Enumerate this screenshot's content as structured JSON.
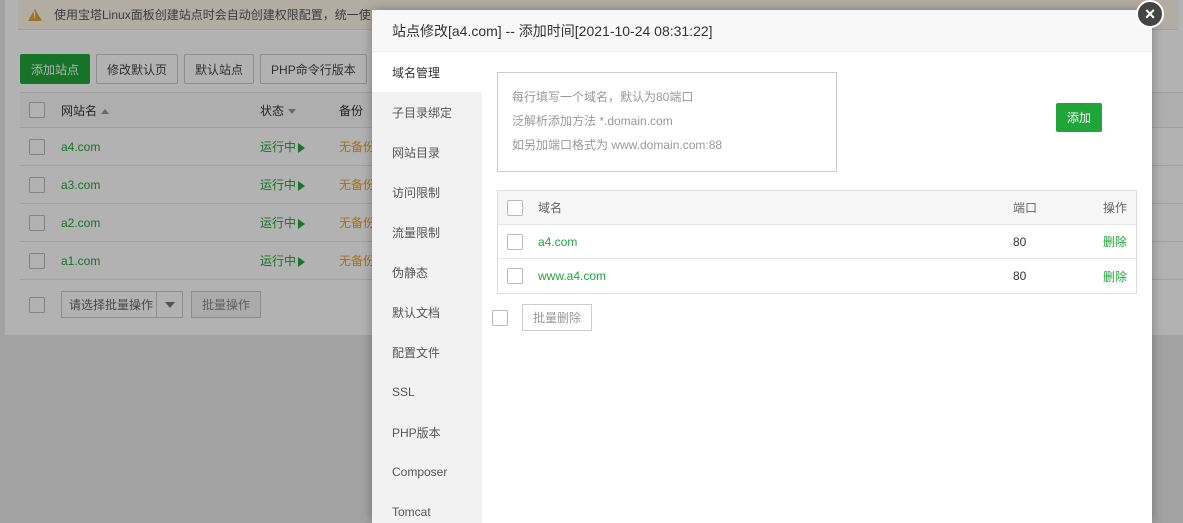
{
  "notice": {
    "text": "使用宝塔Linux面板创建站点时会自动创建权限配置，统一使"
  },
  "toolbar": {
    "add_site": "添加站点",
    "edit_default_page": "修改默认页",
    "default_site": "默认站点",
    "php_cli_version": "PHP命令行版本"
  },
  "site_table": {
    "headers": {
      "name": "网站名",
      "status": "状态",
      "backup": "备份"
    },
    "rows": [
      {
        "name": "a4.com",
        "status": "运行中",
        "backup": "无备份"
      },
      {
        "name": "a3.com",
        "status": "运行中",
        "backup": "无备份"
      },
      {
        "name": "a2.com",
        "status": "运行中",
        "backup": "无备份"
      },
      {
        "name": "a1.com",
        "status": "运行中",
        "backup": "无备份"
      }
    ]
  },
  "batch": {
    "select_placeholder": "请选择批量操作",
    "button": "批量操作"
  },
  "modal": {
    "title": "站点修改[a4.com] -- 添加时间[2021-10-24 08:31:22]",
    "close": "×",
    "menu": [
      "域名管理",
      "子目录绑定",
      "网站目录",
      "访问限制",
      "流量限制",
      "伪静态",
      "默认文档",
      "配置文件",
      "SSL",
      "PHP版本",
      "Composer",
      "Tomcat"
    ],
    "active_menu_index": 0,
    "domain_input": {
      "line1": "每行填写一个域名，默认为80端口",
      "line2": "泛解析添加方法 *.domain.com",
      "line3": "如另加端口格式为 www.domain.com:88"
    },
    "add_button": "添加",
    "table": {
      "headers": {
        "domain": "域名",
        "port": "端口",
        "action": "操作"
      },
      "rows": [
        {
          "domain": "a4.com",
          "port": "80",
          "action": "删除"
        },
        {
          "domain": "www.a4.com",
          "port": "80",
          "action": "删除"
        }
      ]
    },
    "batch_delete": "批量删除"
  },
  "colors": {
    "accent_green": "#20a53a",
    "warning_orange": "#f0a020"
  }
}
